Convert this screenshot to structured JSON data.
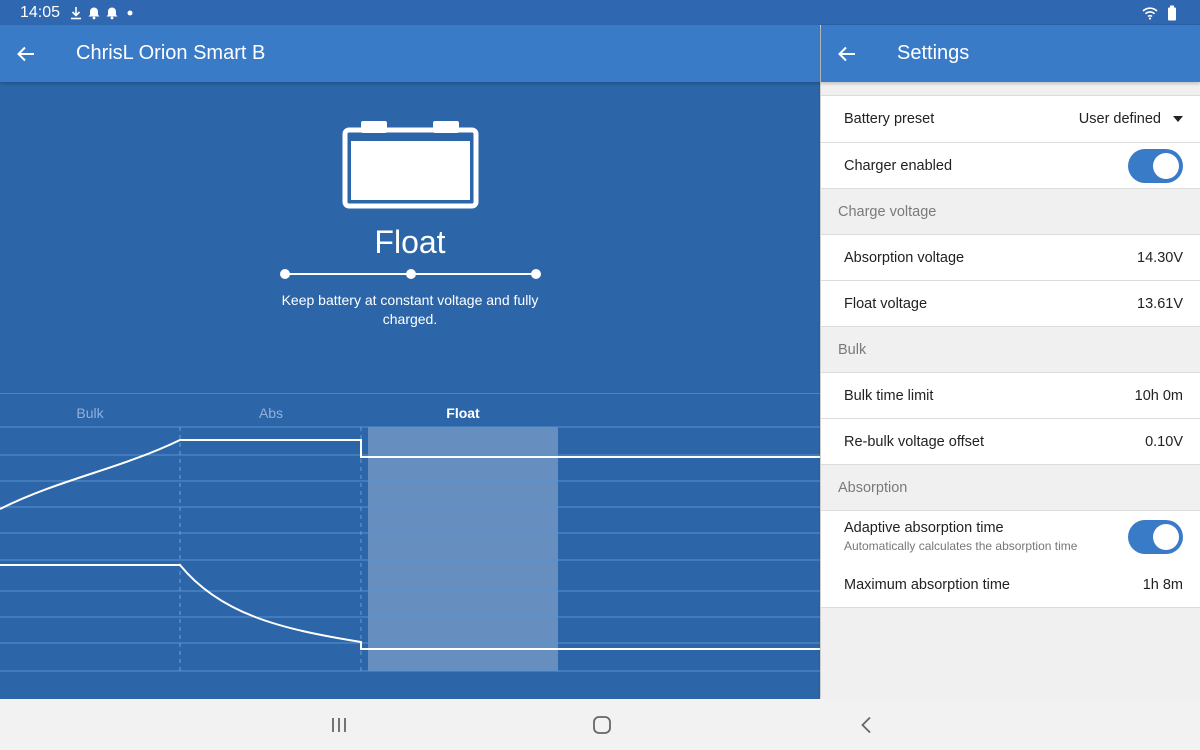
{
  "status_bar": {
    "time": "14:05",
    "left_icons": [
      "download-icon",
      "bell-icon",
      "bell-icon",
      "dot-icon"
    ],
    "right_icons": [
      "wifi-icon",
      "battery-icon"
    ]
  },
  "device_screen": {
    "title": "ChrisL Orion Smart B",
    "state": {
      "name": "Float",
      "description": "Keep battery at constant voltage and fully charged."
    },
    "chart": {
      "phases": [
        "Bulk",
        "Abs",
        "Float"
      ],
      "active_phase": "Float"
    }
  },
  "settings": {
    "title": "Settings",
    "battery_preset": {
      "label": "Battery preset",
      "value": "User defined"
    },
    "charger_enabled": {
      "label": "Charger enabled",
      "on": true
    },
    "section_charge_voltage": "Charge voltage",
    "absorption_voltage": {
      "label": "Absorption voltage",
      "value": "14.30V"
    },
    "float_voltage": {
      "label": "Float voltage",
      "value": "13.61V"
    },
    "section_bulk": "Bulk",
    "bulk_time_limit": {
      "label": "Bulk time limit",
      "value": "10h 0m"
    },
    "rebulk_offset": {
      "label": "Re-bulk voltage offset",
      "value": "0.10V"
    },
    "section_absorption": "Absorption",
    "adaptive_absorption": {
      "label": "Adaptive absorption time",
      "sub": "Automatically calculates the absorption time",
      "on": true
    },
    "max_absorption_time": {
      "label": "Maximum absorption time",
      "value": "1h 8m"
    }
  },
  "colors": {
    "primary": "#3a7bc8",
    "panel_dark": "#2c65a8",
    "toggle_on": "#3a7bc8"
  }
}
